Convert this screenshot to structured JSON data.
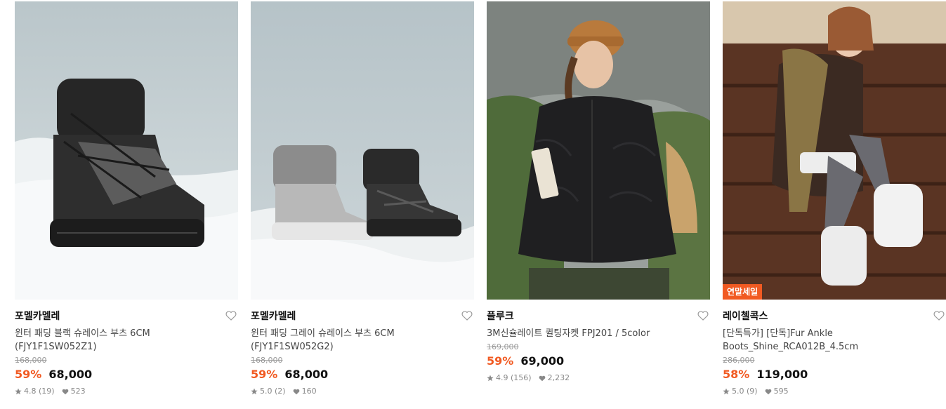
{
  "products": [
    {
      "brand": "포멜카멜레",
      "name": "윈터 패딩 블랙 슈레이스 부츠 6CM (FJY1F1SW052Z1)",
      "original_price": "168,000",
      "discount": "59%",
      "price": "68,000",
      "rating": "4.8 (19)",
      "likes": "523"
    },
    {
      "brand": "포멜카멜레",
      "name": "윈터 패딩 그레이 슈레이스 부츠 6CM (FJY1F1SW052G2)",
      "original_price": "168,000",
      "discount": "59%",
      "price": "68,000",
      "rating": "5.0 (2)",
      "likes": "160"
    },
    {
      "brand": "플루크",
      "name": "3M신슐레이트 퀼팅자켓 FPJ201 / 5color",
      "original_price": "169,000",
      "discount": "59%",
      "price": "69,000",
      "rating": "4.9 (156)",
      "likes": "2,232"
    },
    {
      "brand": "레이첼콕스",
      "name": "[단독특가] [단독]Fur Ankle Boots_Shine_RCA012B_4.5cm",
      "badge": "연말세일",
      "original_price": "286,000",
      "discount": "58%",
      "price": "119,000",
      "rating": "5.0 (9)",
      "likes": "595"
    }
  ],
  "colors": {
    "accent": "#f15a22",
    "text": "#222222",
    "muted": "#888888"
  },
  "icons": {
    "like": "heart-outline-icon",
    "rating": "star-icon",
    "likes": "heart-filled-icon"
  }
}
